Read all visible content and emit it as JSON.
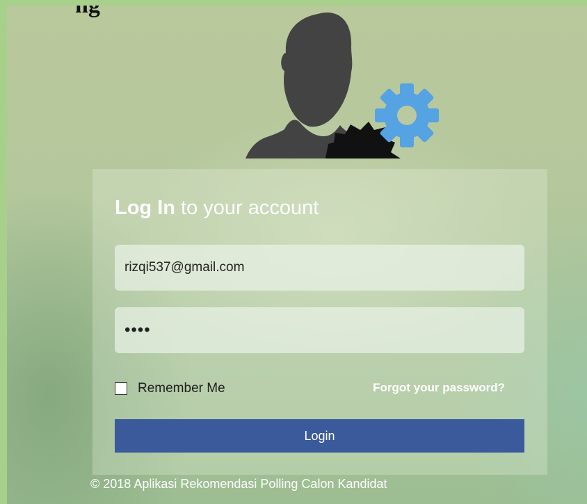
{
  "header": {
    "cut_off_title": "ng"
  },
  "avatar": {
    "icon": "user-settings-icon",
    "colors": {
      "silhouette": "#434343",
      "gear_blue": "#55a3e2",
      "gear_dark": "#111111"
    }
  },
  "login_panel": {
    "title_strong": "Log In",
    "title_rest": " to your account",
    "email_value": "rizqi537@gmail.com",
    "password_mask": "••••",
    "remember_label": "Remember Me",
    "remember_checked": false,
    "forgot_label": "Forgot your password?",
    "login_label": "Login"
  },
  "footer": {
    "text": "© 2018 Aplikasi Rekomendasi Polling Calon Kandidat"
  },
  "colors": {
    "page_border": "#a7d18a",
    "button": "#3a5a9b"
  }
}
